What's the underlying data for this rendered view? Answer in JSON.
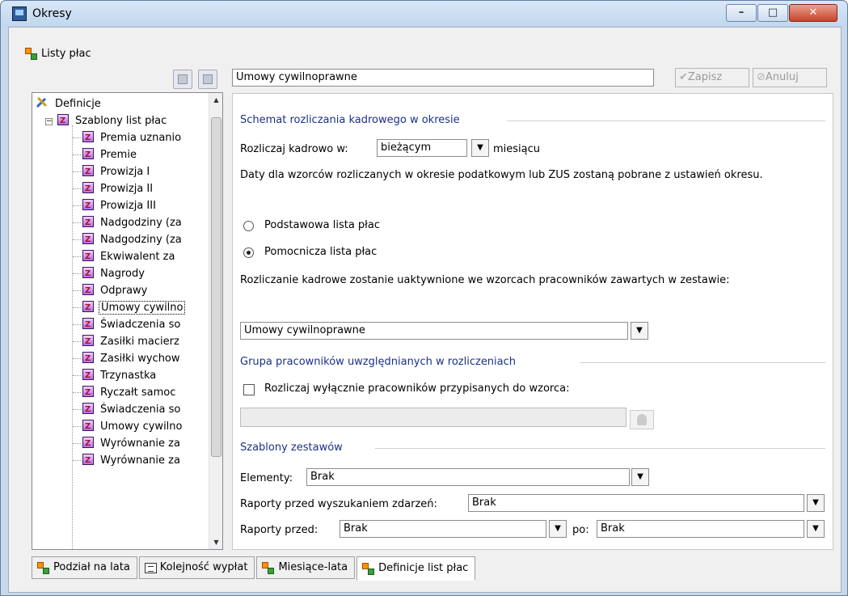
{
  "window": {
    "title": "Okresy",
    "controls": {
      "minimize": "–",
      "maximize": "□",
      "close": "✕"
    }
  },
  "sidebar": {
    "header_label": "Listy płac",
    "tree": {
      "root": "Definicje",
      "group": "Szablony list płac",
      "expander": "−",
      "items": [
        "Premia uznanio",
        "Premie",
        "Prowizja I",
        "Prowizja II",
        "Prowizja III",
        "Nadgodziny (za",
        "Nadgodziny (za",
        "Ekwiwalent za",
        "Nagrody",
        "Odprawy",
        "Umowy cywilno",
        "Świadczenia so",
        "Zasiłki macierz",
        "Zasiłki wychow",
        "Trzynastka",
        "Ryczałt samoc",
        "Świadczenia so",
        "Umowy cywilno",
        "Wyrównanie za",
        "Wyrównanie za"
      ],
      "selected_index": 10
    }
  },
  "top": {
    "name_value": "Umowy cywilnoprawne",
    "save_label": "Zapisz",
    "cancel_label": "Anuluj"
  },
  "main": {
    "schemat_title": "Schemat rozliczania kadrowego w okresie",
    "rozliczaj_label": "Rozliczaj kadrowo w:",
    "rozliczaj_value": "bieżącym",
    "miesiacu": "miesiącu",
    "info_text": "Daty dla wzorców rozliczanych w okresie podatkowym lub ZUS zostaną pobrane z ustawień okresu.",
    "radio_basic": "Podstawowa lista płac",
    "radio_aux": "Pomocnicza lista płac",
    "radio_selected": "aux",
    "activation_text": "Rozliczanie kadrowe zostanie uaktywnione we wzorcach pracowników zawartych w zestawie:",
    "set_value": "Umowy cywilnoprawne",
    "grupa_title": "Grupa pracowników uwzględnianych w rozliczeniach",
    "checkbox_label": "Rozliczaj wyłącznie pracowników przypisanych do wzorca:",
    "checkbox_checked": false,
    "workers_value": "",
    "szablony_title": "Szablony zestawów",
    "elementy_label": "Elementy:",
    "elementy_value": "Brak",
    "raporty_wyszuk_label": "Raporty przed wyszukaniem zdarzeń:",
    "raporty_wyszuk_value": "Brak",
    "raporty_przed_label": "Raporty przed:",
    "raporty_przed_value": "Brak",
    "po_label": "po:",
    "po_value": "Brak"
  },
  "tabs": [
    {
      "label": "Podział na lata"
    },
    {
      "label": "Kolejność wypłat"
    },
    {
      "label": "Miesiące-lata"
    },
    {
      "label": "Definicje list płac"
    }
  ],
  "active_tab": 3
}
